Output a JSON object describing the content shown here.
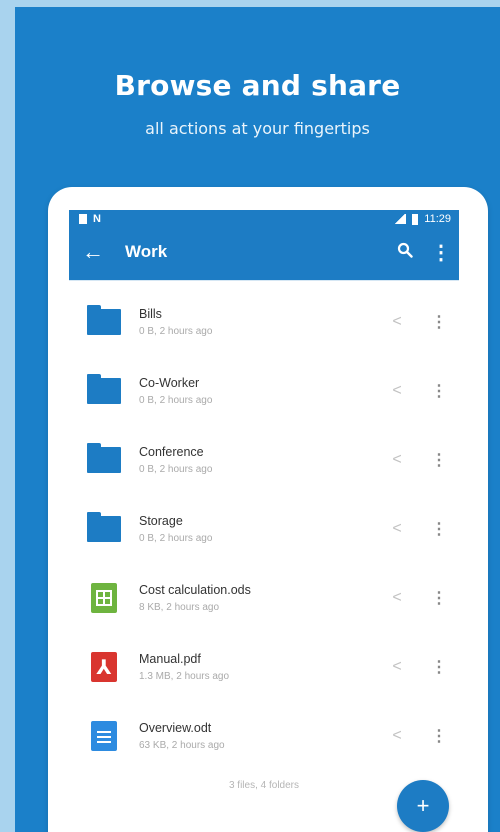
{
  "promo": {
    "headline": "Browse and share",
    "subheadline": "all actions at your fingertips"
  },
  "status_bar": {
    "left_icons": [
      "sim-icon",
      "n-badge-icon"
    ],
    "right_icons": [
      "signal-icon",
      "battery-icon"
    ],
    "time": "11:29"
  },
  "toolbar": {
    "back_icon": "back-arrow-icon",
    "back_glyph": "←",
    "title": "Work",
    "search_icon": "search-icon",
    "search_glyph": "🔍",
    "more_icon": "more-vert-icon",
    "more_glyph": "⋮"
  },
  "files": [
    {
      "name": "Bills",
      "meta": "0 B, 2 hours ago",
      "type": "folder"
    },
    {
      "name": "Co-Worker",
      "meta": "0 B, 2 hours ago",
      "type": "folder"
    },
    {
      "name": "Conference",
      "meta": "0 B, 2 hours ago",
      "type": "folder"
    },
    {
      "name": "Storage",
      "meta": "0 B, 2 hours ago",
      "type": "folder"
    },
    {
      "name": "Cost calculation.ods",
      "meta": "8 KB, 2 hours ago",
      "type": "spreadsheet"
    },
    {
      "name": "Manual.pdf",
      "meta": "1.3 MB, 2 hours ago",
      "type": "pdf"
    },
    {
      "name": "Overview.odt",
      "meta": "63 KB, 2 hours ago",
      "type": "document"
    }
  ],
  "row_actions": {
    "share_glyph": "<",
    "menu_glyph": "⋮"
  },
  "pdf_glyph": "⅄",
  "footer": {
    "summary": "3 files, 4 folders"
  },
  "fab": {
    "glyph": "+",
    "icon": "add-icon"
  },
  "colors": {
    "brand_blue": "#1d7cc4",
    "background": "#1b80c9",
    "spreadsheet": "#6eb43f",
    "pdf": "#d9352f",
    "document": "#2d8be0"
  }
}
